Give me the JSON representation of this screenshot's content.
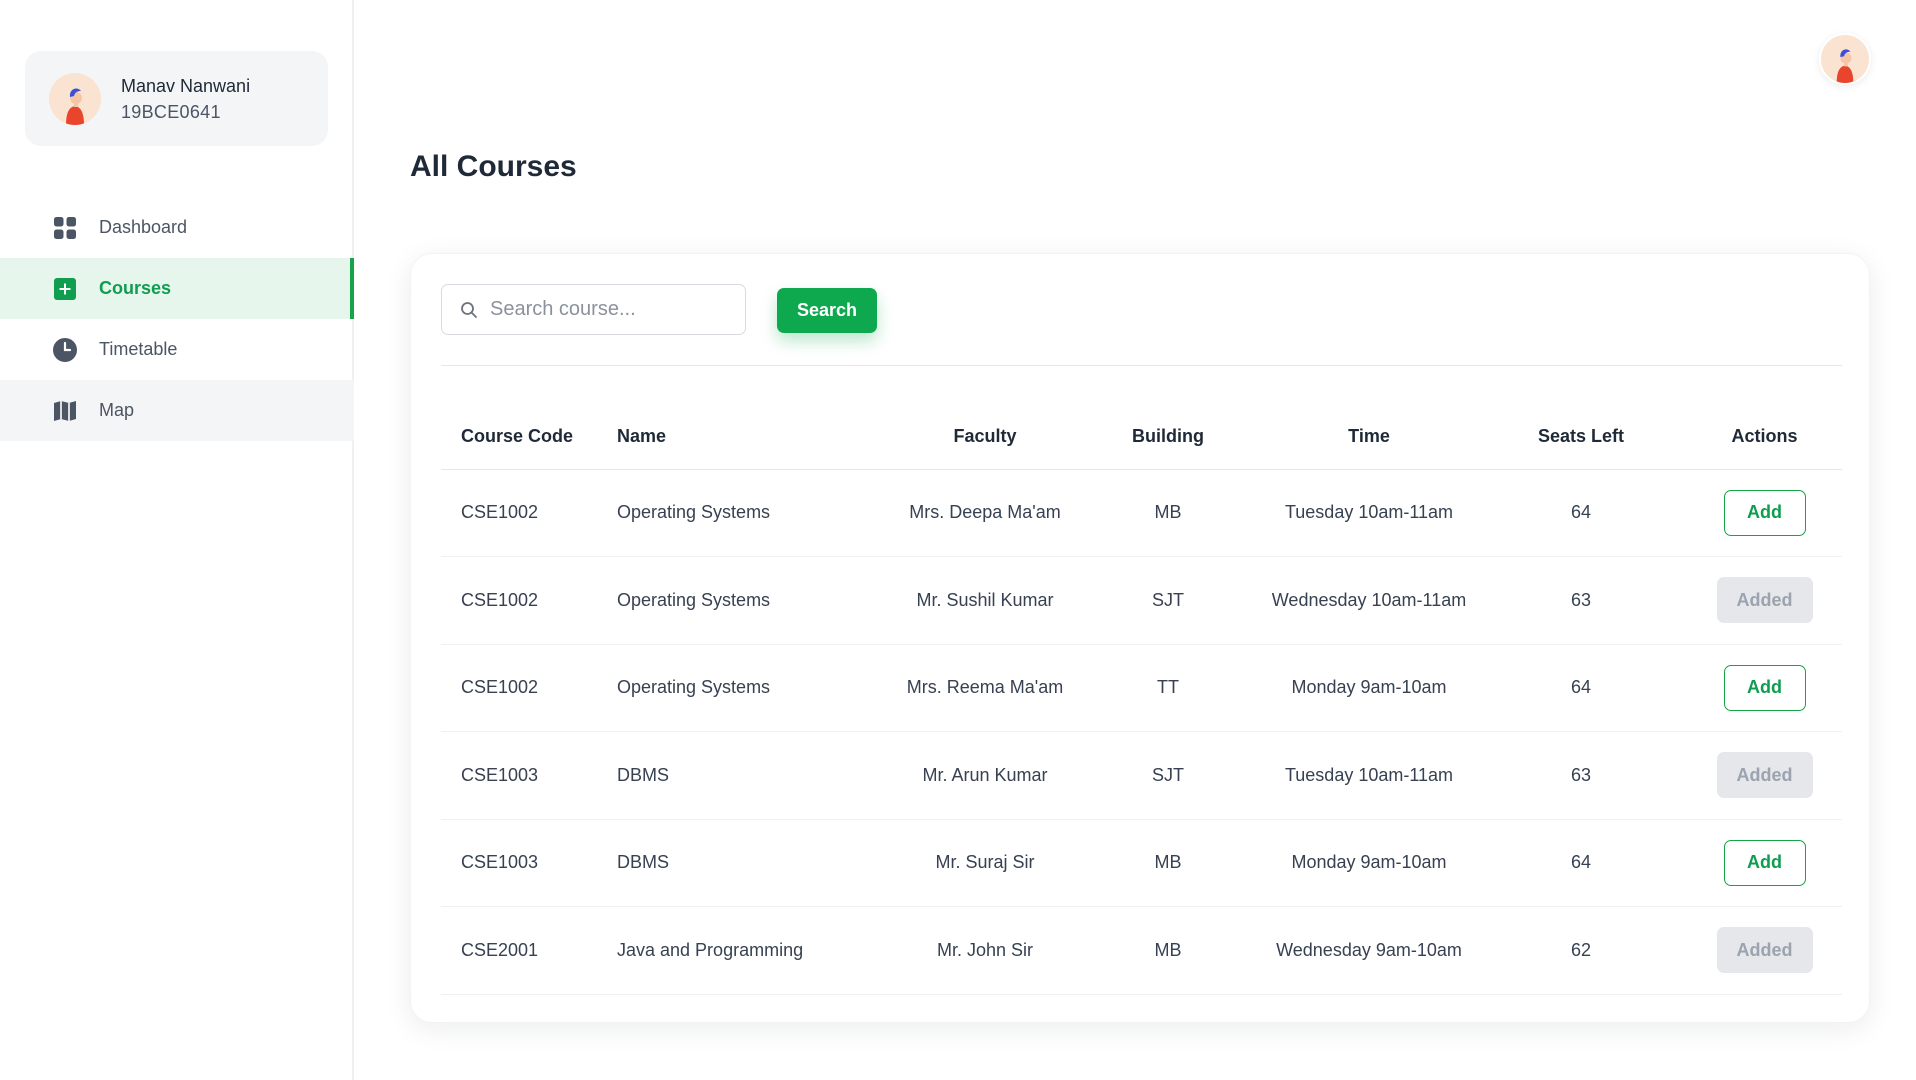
{
  "user": {
    "name": "Manav Nanwani",
    "id": "19BCE0641"
  },
  "sidebar": {
    "items": [
      {
        "label": "Dashboard",
        "icon": "grid-icon"
      },
      {
        "label": "Courses",
        "icon": "plus-square-icon",
        "active": true
      },
      {
        "label": "Timetable",
        "icon": "clock-icon"
      },
      {
        "label": "Map",
        "icon": "map-icon"
      }
    ]
  },
  "page": {
    "title": "All Courses"
  },
  "search": {
    "placeholder": "Search course...",
    "value": "",
    "button_label": "Search"
  },
  "table": {
    "headers": [
      "Course Code",
      "Name",
      "Faculty",
      "Building",
      "Time",
      "Seats Left",
      "Actions"
    ],
    "rows": [
      {
        "code": "CSE1002",
        "name": "Operating Systems",
        "faculty": "Mrs. Deepa Ma'am",
        "building": "MB",
        "time": "Tuesday 10am-11am",
        "seats": "64",
        "action": "Add"
      },
      {
        "code": "CSE1002",
        "name": "Operating Systems",
        "faculty": "Mr. Sushil Kumar",
        "building": "SJT",
        "time": "Wednesday 10am-11am",
        "seats": "63",
        "action": "Added"
      },
      {
        "code": "CSE1002",
        "name": "Operating Systems",
        "faculty": "Mrs. Reema Ma'am",
        "building": "TT",
        "time": "Monday 9am-10am",
        "seats": "64",
        "action": "Add"
      },
      {
        "code": "CSE1003",
        "name": "DBMS",
        "faculty": "Mr. Arun Kumar",
        "building": "SJT",
        "time": "Tuesday 10am-11am",
        "seats": "63",
        "action": "Added"
      },
      {
        "code": "CSE1003",
        "name": "DBMS",
        "faculty": "Mr. Suraj Sir",
        "building": "MB",
        "time": "Monday 9am-10am",
        "seats": "64",
        "action": "Add"
      },
      {
        "code": "CSE2001",
        "name": "Java and Programming",
        "faculty": "Mr. John Sir",
        "building": "MB",
        "time": "Wednesday 9am-10am",
        "seats": "62",
        "action": "Added"
      }
    ]
  },
  "colors": {
    "accent": "#0ea84f",
    "accent_light": "#e7f6ec",
    "added_bg": "#e5e7eb",
    "added_text": "#9ca3af"
  }
}
